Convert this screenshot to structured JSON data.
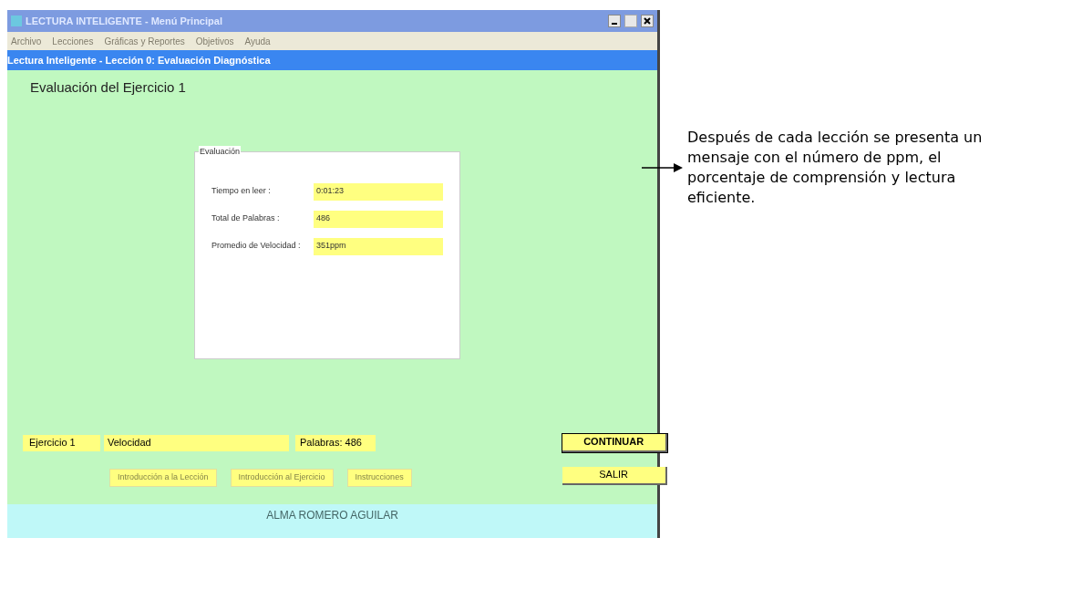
{
  "window": {
    "title": "LECTURA INTELIGENTE - Menú Principal"
  },
  "menu": [
    {
      "label": "Archivo",
      "disabled": true
    },
    {
      "label": "Lecciones",
      "disabled": true
    },
    {
      "label": "Gráficas y Reportes",
      "disabled": true
    },
    {
      "label": "Objetivos",
      "disabled": true
    },
    {
      "label": "Ayuda",
      "disabled": true
    }
  ],
  "header_bar": "Lectura Inteligente - Lección 0: Evaluación Diagnóstica",
  "heading": "Evaluación del Ejercicio 1",
  "evaluation": {
    "legend": "Evaluación",
    "fields": [
      {
        "label": "Tiempo en leer :",
        "value": "0:01:23"
      },
      {
        "label": "Total de Palabras :",
        "value": "486"
      },
      {
        "label": "Promedio de Velocidad :",
        "value": "351ppm"
      }
    ]
  },
  "exercise_bar": {
    "label": "Ejercicio 1",
    "name": "Velocidad",
    "words": "Palabras: 486"
  },
  "buttons": [
    {
      "label": "CONTINUAR",
      "disabled": false,
      "default": true
    },
    {
      "label": "Introducción a la Lección",
      "disabled": true,
      "default": false
    },
    {
      "label": "Introducción al Ejercicio",
      "disabled": true,
      "default": false
    },
    {
      "label": "Instrucciones",
      "disabled": true,
      "default": false
    },
    {
      "label": "SALIR",
      "disabled": false,
      "default": false
    }
  ],
  "footer": "ALMA ROMERO AGUILAR",
  "annotation": "Después de cada lección se presenta un mensaje con el número de ppm, el porcentaje de comprensión y lectura eficiente."
}
